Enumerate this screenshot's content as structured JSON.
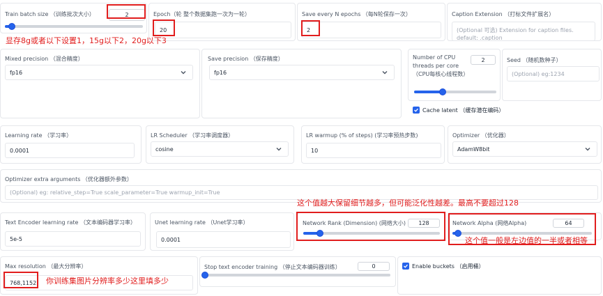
{
  "row1": {
    "batch": {
      "label": "Train batch size （训练批次大小）",
      "value": "2",
      "slider_fraction": 0.05
    },
    "epoch": {
      "label": "Epoch（轮 整个数据集跑一次为一轮）",
      "value": "20"
    },
    "save_every": {
      "label": "Save every N epochs （每N轮保存一次）",
      "value": "2"
    },
    "caption_ext": {
      "label": "Caption Extension （打标文件扩展名）",
      "placeholder": "(Optional 可选) Extension for caption files. default: .caption"
    }
  },
  "note_vram": "显存8g或者以下设置1，15g以下2，20g以下3",
  "row2": {
    "mixed_precision": {
      "label": "Mixed precision （混合精度）",
      "value": "fp16"
    },
    "save_precision": {
      "label": "Save precision （保存精度）",
      "value": "fp16"
    },
    "cpu_threads": {
      "label": "Number of CPU threads per core （CPU每核心线程数）",
      "value": "2",
      "slider_fraction": 0.35
    },
    "seed": {
      "label": "Seed （随机数种子）",
      "placeholder": "(Optional) eg:1234"
    },
    "cache_latent": {
      "label": "Cache latent （缓存潜在编码）",
      "checked": true
    }
  },
  "row3": {
    "lr": {
      "label": "Learning rate （学习率）",
      "value": "0.0001"
    },
    "scheduler": {
      "label": "LR Scheduler （学习率调度器）",
      "value": "cosine"
    },
    "warmup": {
      "label": "LR warmup (% of steps) (学习率预热步数)",
      "value": "10"
    },
    "optimizer": {
      "label": "Optimizer （优化器）",
      "value": "AdamW8bit"
    }
  },
  "row4": {
    "extra_args": {
      "label": "Optimizer extra arguments （优化器额外参数）",
      "placeholder": "(Optional) eg: relative_step=True scale_parameter=True warmup_init=True"
    }
  },
  "note_rank": "这个值越大保留细节越多，但可能泛化性越差。最高不要超过128",
  "row5": {
    "te_lr": {
      "label": "Text Encoder learning rate （文本编码器学习率）",
      "value": "5e-5"
    },
    "unet_lr": {
      "label": "Unet learning rate （Unet学习率）",
      "value": "0.0001"
    },
    "net_rank": {
      "label": "Network Rank (Dimension) (网络大小)",
      "value": "128",
      "slider_fraction": 0.12
    },
    "net_alpha": {
      "label": "Network Alpha (网络Alpha)",
      "value": "64",
      "slider_fraction": 0.04
    }
  },
  "note_alpha": "这个值一般是左边值的一半或者相等",
  "row6": {
    "max_res": {
      "label": "Max resolution （最大分辨率）",
      "value": "768,1152"
    },
    "stop_te": {
      "label": "Stop text encoder training （停止文本编码器训练）",
      "value": "0",
      "slider_fraction": 0.0
    },
    "buckets": {
      "label": "Enable buckets （启用桶）",
      "checked": true
    }
  },
  "note_res": "你训练集图片分辨率多少这里填多少",
  "colors": {
    "accent": "#2563eb",
    "annotation_red": "#e11d1d"
  }
}
